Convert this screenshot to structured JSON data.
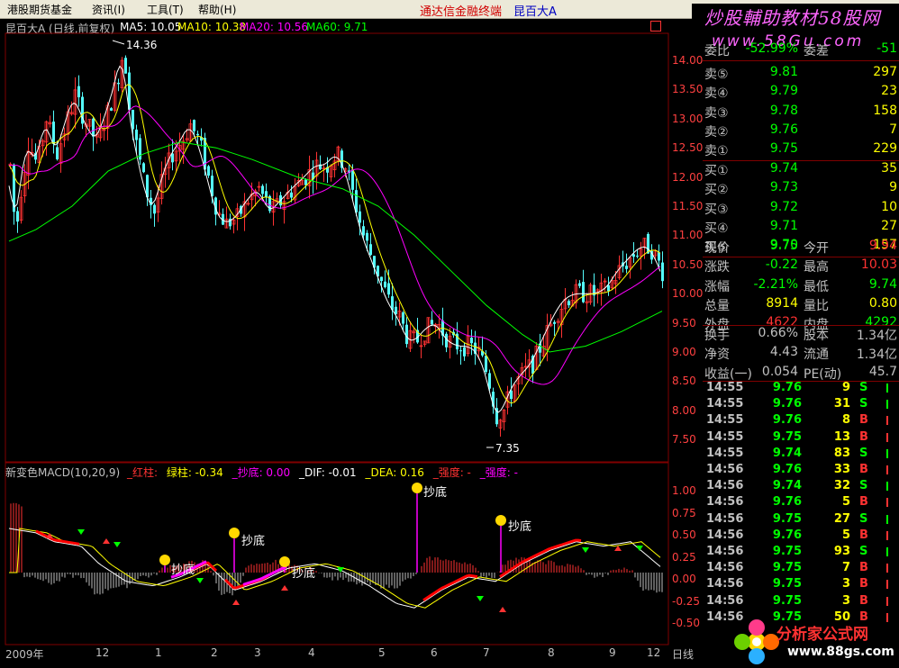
{
  "menu": {
    "items": [
      "港股期货基金",
      "资讯(I)",
      "工具(T)",
      "帮助(H)"
    ],
    "center_title": "通达信金融终端",
    "stock_title": "昆百大A"
  },
  "watermark": {
    "line1": "炒股輔助教材58股网",
    "line2": "www.58Gu.com"
  },
  "chart": {
    "header": "昆百大A (日线,前复权)",
    "ma5": "MA5: 10.05",
    "ma10": "MA10: 10.38",
    "ma20": "MA20: 10.56",
    "ma60": "MA60: 9.71",
    "high_label": "14.36",
    "low_label": "7.35",
    "price_ticks": [
      "14.00",
      "13.50",
      "13.00",
      "12.50",
      "12.00",
      "11.50",
      "11.00",
      "10.50",
      "10.00",
      "9.50",
      "9.00",
      "8.50",
      "8.00",
      "7.50"
    ],
    "macd_header": "新变色MACD(10,20,9)",
    "macd_red": "_红柱: ",
    "macd_green": "绿柱: -0.34",
    "macd_chaodi": "_抄底: 0.00",
    "macd_dif": "_DIF: -0.01",
    "macd_dea": "_DEA: 0.16",
    "macd_strong": "_强度: -",
    "macd_strong2": "_强度: -",
    "macd_ticks": [
      "1.00",
      "0.75",
      "0.50",
      "0.25",
      "0.00",
      "-0.25",
      "-0.50"
    ],
    "chaodi_label": "抄底",
    "date_ticks": [
      "2009年",
      "12",
      "1",
      "2",
      "3",
      "4",
      "5",
      "6",
      "7",
      "8",
      "9",
      "12"
    ],
    "period": "日线",
    "colors": {
      "up": "#ff3232",
      "down": "#54fcfc",
      "ma5": "#ffffff",
      "ma10": "#ffff00",
      "ma20": "#ff00ff",
      "ma60": "#00ff00"
    }
  },
  "quote": {
    "top_partial": {
      "label1": "委比",
      "val1": "-52.99%",
      "label2": "委差",
      "val2": "-51"
    },
    "asks": [
      {
        "label": "卖⑤",
        "price": "9.81",
        "vol": "297"
      },
      {
        "label": "卖④",
        "price": "9.79",
        "vol": "23"
      },
      {
        "label": "卖③",
        "price": "9.78",
        "vol": "158"
      },
      {
        "label": "卖②",
        "price": "9.76",
        "vol": "7"
      },
      {
        "label": "卖①",
        "price": "9.75",
        "vol": "229"
      }
    ],
    "bids": [
      {
        "label": "买①",
        "price": "9.74",
        "vol": "35"
      },
      {
        "label": "买②",
        "price": "9.73",
        "vol": "9"
      },
      {
        "label": "买③",
        "price": "9.72",
        "vol": "10"
      },
      {
        "label": "买④",
        "price": "9.71",
        "vol": "27"
      },
      {
        "label": "买⑤",
        "price": "9.70",
        "vol": "157"
      }
    ],
    "stats": [
      {
        "l1": "现价",
        "v1": "9.75",
        "l2": "今开",
        "v2": "9.94",
        "c1": "#00ff00",
        "c2": "#ff3232"
      },
      {
        "l1": "涨跌",
        "v1": "-0.22",
        "l2": "最高",
        "v2": "10.03",
        "c1": "#00ff00",
        "c2": "#ff3232"
      },
      {
        "l1": "涨幅",
        "v1": "-2.21%",
        "l2": "最低",
        "v2": "9.74",
        "c1": "#00ff00",
        "c2": "#00ff00"
      },
      {
        "l1": "总量",
        "v1": "8914",
        "l2": "量比",
        "v2": "0.80",
        "c1": "#ffff00",
        "c2": "#ffff00"
      },
      {
        "l1": "外盘",
        "v1": "4622",
        "l2": "内盘",
        "v2": "4292",
        "c1": "#ff3232",
        "c2": "#00ff00"
      }
    ],
    "stats2": [
      {
        "l1": "换手",
        "v1": "0.66%",
        "l2": "股本",
        "v2": "1.34亿"
      },
      {
        "l1": "净资",
        "v1": "4.43",
        "l2": "流通",
        "v2": "1.34亿"
      },
      {
        "l1": "收益(一)",
        "v1": "0.054",
        "l2": "PE(动)",
        "v2": "45.7"
      }
    ],
    "ticks": [
      {
        "t": "14:55",
        "p": "9.76",
        "v": "9",
        "s": "S"
      },
      {
        "t": "14:55",
        "p": "9.76",
        "v": "31",
        "s": "S"
      },
      {
        "t": "14:55",
        "p": "9.76",
        "v": "8",
        "s": "B"
      },
      {
        "t": "14:55",
        "p": "9.75",
        "v": "13",
        "s": "B"
      },
      {
        "t": "14:55",
        "p": "9.74",
        "v": "83",
        "s": "S"
      },
      {
        "t": "14:56",
        "p": "9.76",
        "v": "33",
        "s": "B"
      },
      {
        "t": "14:56",
        "p": "9.74",
        "v": "32",
        "s": "S"
      },
      {
        "t": "14:56",
        "p": "9.76",
        "v": "5",
        "s": "B"
      },
      {
        "t": "14:56",
        "p": "9.75",
        "v": "27",
        "s": "S"
      },
      {
        "t": "14:56",
        "p": "9.76",
        "v": "5",
        "s": "B"
      },
      {
        "t": "14:56",
        "p": "9.75",
        "v": "93",
        "s": "S"
      },
      {
        "t": "14:56",
        "p": "9.75",
        "v": "7",
        "s": "B"
      },
      {
        "t": "14:56",
        "p": "9.75",
        "v": "3",
        "s": "B"
      },
      {
        "t": "14:56",
        "p": "9.75",
        "v": "3",
        "s": "B"
      },
      {
        "t": "14:56",
        "p": "9.75",
        "v": "50",
        "s": "B"
      }
    ]
  },
  "logo": {
    "line1": "分析家公式网",
    "line2": "www.88gs.com"
  }
}
